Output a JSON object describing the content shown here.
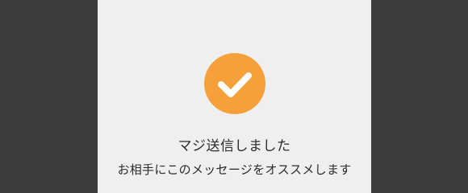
{
  "colors": {
    "backdrop": "#3b3c3b",
    "modal_background": "#efefef",
    "accent": "#f6a03c",
    "check": "#ffffff"
  },
  "dialog": {
    "icon": "checkmark-icon",
    "title": "マジ送信しました",
    "message": "お相手にこのメッセージをオススメします"
  }
}
